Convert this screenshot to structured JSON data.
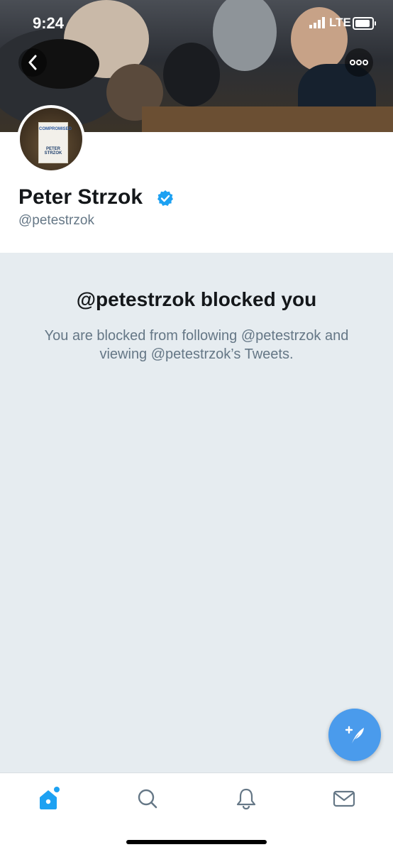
{
  "status_bar": {
    "time": "9:24",
    "network": "LTE"
  },
  "profile": {
    "avatar_book_title": "COMPROMISED",
    "avatar_book_author": "PETER STRZOK",
    "name": "Peter Strzok",
    "handle": "@petestrzok",
    "verified": true
  },
  "blocked": {
    "title": "@petestrzok blocked you",
    "message": "You are blocked from following @petestrzok and viewing @petestrzok’s Tweets."
  },
  "tabbar": {
    "items": [
      {
        "icon": "home-icon",
        "active": true
      },
      {
        "icon": "search-icon",
        "active": false
      },
      {
        "icon": "notifications-icon",
        "active": false
      },
      {
        "icon": "messages-icon",
        "active": false
      }
    ]
  },
  "colors": {
    "accent": "#1da1f2",
    "fab": "#4a9bec",
    "muted": "#657786",
    "background": "#e6ecf0"
  }
}
